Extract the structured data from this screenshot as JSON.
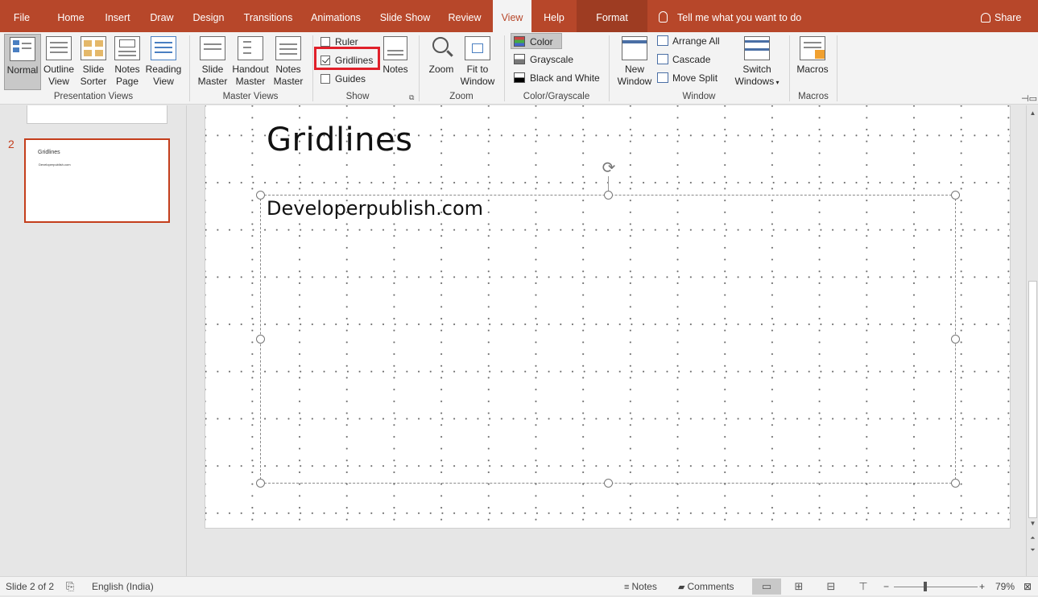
{
  "tabs": [
    {
      "label": "File",
      "active": false
    },
    {
      "label": "Home",
      "active": false
    },
    {
      "label": "Insert",
      "active": false
    },
    {
      "label": "Draw",
      "active": false
    },
    {
      "label": "Design",
      "active": false
    },
    {
      "label": "Transitions",
      "active": false
    },
    {
      "label": "Animations",
      "active": false
    },
    {
      "label": "Slide Show",
      "active": false
    },
    {
      "label": "Review",
      "active": false
    },
    {
      "label": "View",
      "active": true
    },
    {
      "label": "Help",
      "active": false
    },
    {
      "label": "Format",
      "active": false
    }
  ],
  "tell_me": "Tell me what you want to do",
  "share": "Share",
  "ribbon": {
    "presentation_views": {
      "label": "Presentation Views",
      "normal": "Normal",
      "outline": [
        "Outline",
        "View"
      ],
      "sorter": [
        "Slide",
        "Sorter"
      ],
      "notes_page": [
        "Notes",
        "Page"
      ],
      "reading": [
        "Reading",
        "View"
      ]
    },
    "master_views": {
      "label": "Master Views",
      "slide": [
        "Slide",
        "Master"
      ],
      "handout": [
        "Handout",
        "Master"
      ],
      "notes": [
        "Notes",
        "Master"
      ]
    },
    "show": {
      "label": "Show",
      "ruler": "Ruler",
      "gridlines": "Gridlines",
      "guides": "Guides",
      "notes": "Notes",
      "gridlines_checked": true
    },
    "zoom": {
      "label": "Zoom",
      "zoom": "Zoom",
      "fit": [
        "Fit to",
        "Window"
      ]
    },
    "color": {
      "label": "Color/Grayscale",
      "color": "Color",
      "grayscale": "Grayscale",
      "bw": "Black and White"
    },
    "window": {
      "label": "Window",
      "new": [
        "New",
        "Window"
      ],
      "arrange": "Arrange All",
      "cascade": "Cascade",
      "move_split": "Move Split",
      "switch": [
        "Switch",
        "Windows"
      ]
    },
    "macros": {
      "label": "Macros",
      "macros": "Macros"
    }
  },
  "thumbnails": {
    "slide2_number": "2",
    "slide2_title": "Gridlines",
    "slide2_body": "Developerpublish.com"
  },
  "slide": {
    "title": "Gridlines",
    "body": "Developerpublish.com"
  },
  "status": {
    "slide_count": "Slide 2 of 2",
    "language": "English (India)",
    "notes": "Notes",
    "comments": "Comments",
    "zoom_percent": "79%",
    "zoom_minus": "−",
    "zoom_plus": "+"
  },
  "colors": {
    "accent": "#b7472a",
    "highlight": "#e0202a"
  }
}
